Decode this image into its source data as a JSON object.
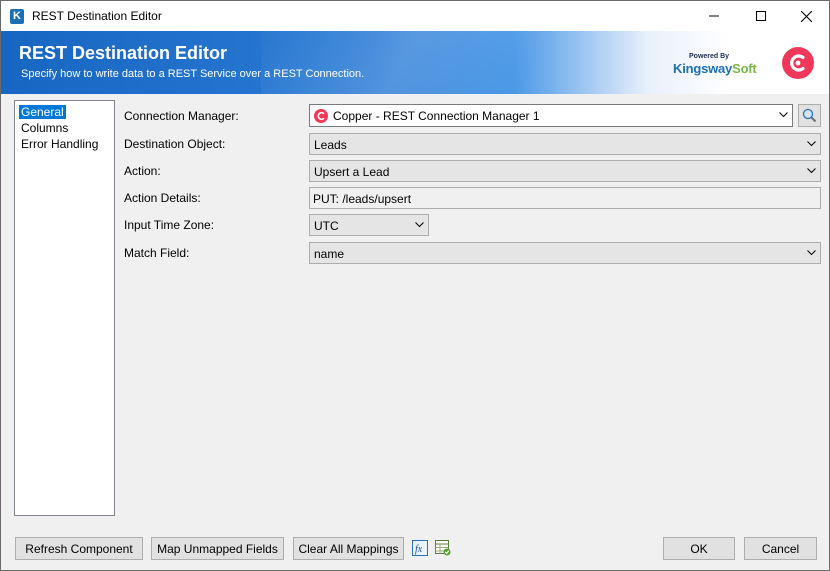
{
  "window": {
    "title": "REST Destination Editor"
  },
  "banner": {
    "title": "REST Destination Editor",
    "subtitle": "Specify how to write data to a REST Service over a REST Connection.",
    "brand_powered": "Powered By",
    "brand_name_main": "Kingsway",
    "brand_name_soft": "Soft"
  },
  "nav": {
    "items": [
      {
        "label": "General",
        "selected": true
      },
      {
        "label": "Columns",
        "selected": false
      },
      {
        "label": "Error Handling",
        "selected": false
      }
    ]
  },
  "form": {
    "connection_manager": {
      "label": "Connection Manager:",
      "value": "Copper - REST Connection Manager 1"
    },
    "destination_object": {
      "label": "Destination Object:",
      "value": "Leads"
    },
    "action": {
      "label": "Action:",
      "value": "Upsert a Lead"
    },
    "action_details": {
      "label": "Action Details:",
      "value": "PUT: /leads/upsert"
    },
    "input_time_zone": {
      "label": "Input Time Zone:",
      "value": "UTC"
    },
    "match_field": {
      "label": "Match Field:",
      "value": "name"
    }
  },
  "buttons": {
    "refresh": "Refresh Component",
    "map_unmapped": "Map Unmapped Fields",
    "clear_mappings": "Clear All Mappings",
    "ok": "OK",
    "cancel": "Cancel"
  },
  "icons": {
    "app": "K",
    "fx": "fx"
  },
  "colors": {
    "selection": "#0078d7",
    "copper": "#f2385a",
    "banner_blue": "#1766c2"
  }
}
